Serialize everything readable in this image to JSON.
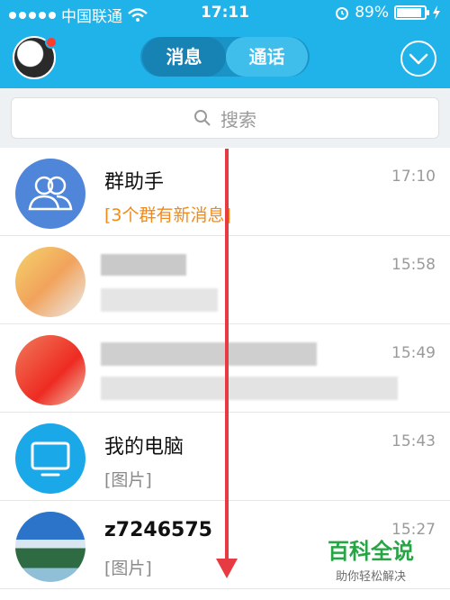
{
  "status_bar": {
    "carrier": "中国联通",
    "time": "17:11",
    "battery_percent": "89%",
    "battery_level": 0.89
  },
  "header": {
    "tabs": [
      {
        "label": "消息",
        "selected": true
      },
      {
        "label": "通话",
        "selected": false
      }
    ]
  },
  "search": {
    "placeholder": "搜索"
  },
  "conversations": [
    {
      "title": "群助手",
      "preview": "[3个群有新消息]",
      "time": "17:10",
      "avatar_color": "#4f86d9"
    },
    {
      "title": "",
      "preview": "",
      "time": "15:58"
    },
    {
      "title": "",
      "preview": "",
      "time": "15:49"
    },
    {
      "title": "我的电脑",
      "preview": "[图片]",
      "time": "15:43",
      "avatar_color": "#1aa8e8"
    },
    {
      "title": "z7246575",
      "preview": "[图片]",
      "time": "15:27"
    }
  ],
  "watermark": {
    "brand": "百科全说",
    "tagline": "助你轻松解决"
  },
  "colors": {
    "header_bg": "#1fb3ea",
    "arrow": "#e73b43",
    "orange_text": "#f08a1a",
    "watermark_green": "#27a545"
  }
}
